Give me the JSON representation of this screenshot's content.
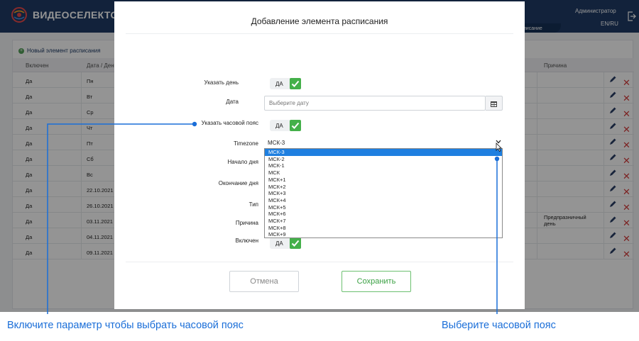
{
  "header": {
    "logo_text": "ВИДЕОСЕЛЕКТОР",
    "user_name": "Администратор",
    "language": "EN/RU",
    "active_tab_label": "писание"
  },
  "page": {
    "add_label": "Новый элемент расписания",
    "columns": [
      "Включен",
      "Дата / Ден",
      "Причина"
    ],
    "rows": [
      {
        "enabled": "Да",
        "day": "Пн",
        "reason": ""
      },
      {
        "enabled": "Да",
        "day": "Вт",
        "reason": ""
      },
      {
        "enabled": "Да",
        "day": "Ср",
        "reason": ""
      },
      {
        "enabled": "Да",
        "day": "Чт",
        "reason": ""
      },
      {
        "enabled": "Да",
        "day": "Пт",
        "reason": ""
      },
      {
        "enabled": "Да",
        "day": "Сб",
        "reason": ""
      },
      {
        "enabled": "Да",
        "day": "Вс",
        "reason": ""
      },
      {
        "enabled": "Да",
        "day": "22.10.2021",
        "reason": ""
      },
      {
        "enabled": "Да",
        "day": "26.10.2021",
        "reason": ""
      },
      {
        "enabled": "Да",
        "day": "03.11.2021",
        "reason": "Предпразничный день"
      },
      {
        "enabled": "Да",
        "day": "04.11.2021",
        "reason": ""
      },
      {
        "enabled": "Да",
        "day": "09.11.2021",
        "reason": ""
      }
    ]
  },
  "modal": {
    "title": "Добавление элемента расписания",
    "specify_day_label": "Указать день",
    "specify_day_toggle": "ДА",
    "date_label": "Дата",
    "date_placeholder": "Выберите дату",
    "specify_tz_label": "Указать часовой пояс",
    "specify_tz_toggle": "ДА",
    "timezone_label": "Timezone",
    "timezone_value": "МСК-3",
    "timezone_options": [
      "МСК-3",
      "МСК-2",
      "МСК-1",
      "МСК",
      "МСК+1",
      "МСК+2",
      "МСК+3",
      "МСК+4",
      "МСК+5",
      "МСК+6",
      "МСК+7",
      "МСК+8",
      "МСК+9"
    ],
    "day_start_label": "Начало дня",
    "day_end_label": "Окончание дня",
    "type_label": "Тип",
    "reason_label": "Причина",
    "enabled_label": "Включен",
    "enabled_toggle": "ДА",
    "cancel_label": "Отмена",
    "save_label": "Сохранить"
  },
  "callouts": {
    "left": "Включите параметр чтобы выбрать часовой пояс",
    "right": "Выберите часовой пояс"
  },
  "colors": {
    "header_bg": "#1f3b66",
    "accent_green": "#44b04a",
    "callout_blue": "#1a6ed8",
    "delete_red": "#d53a3a",
    "selected_option": "#1e7fe0"
  }
}
